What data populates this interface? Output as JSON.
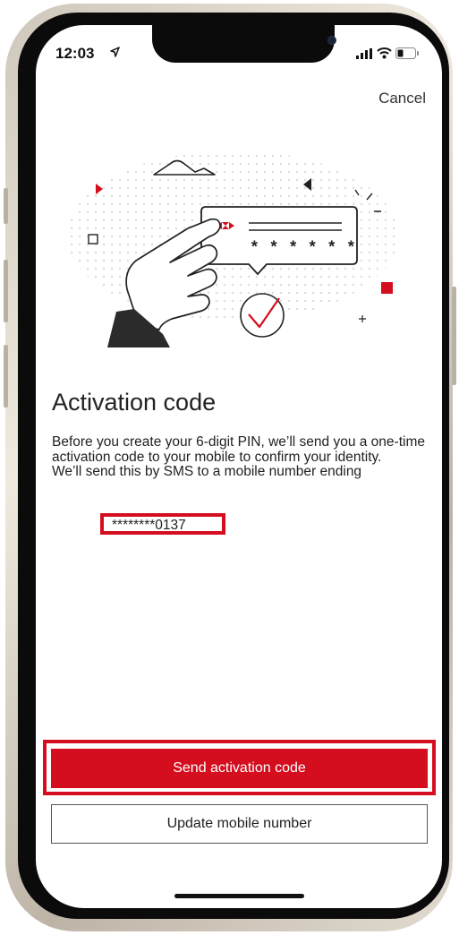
{
  "status_bar": {
    "time": "12:03",
    "icons": [
      "location-arrow-icon",
      "cellular-signal-icon",
      "wifi-icon",
      "battery-icon"
    ]
  },
  "header": {
    "cancel_label": "Cancel"
  },
  "main": {
    "title": "Activation code",
    "paragraph_1": "Before you create your 6-digit PIN, we’ll send you a one-time activation code to your mobile to confirm your identity.",
    "paragraph_2": "We’ll send this by SMS to a mobile number ending",
    "masked_number": "********0137"
  },
  "illustration": {
    "masked_code": "* * * * * *",
    "icons": [
      "hand-tapping-icon",
      "hsbc-logo-icon",
      "check-circle-icon",
      "mountain-icon"
    ]
  },
  "actions": {
    "primary_label": "Send activation code",
    "secondary_label": "Update mobile number"
  },
  "colors": {
    "brand_red": "#d40e1e",
    "text": "#222222",
    "background": "#ffffff"
  }
}
